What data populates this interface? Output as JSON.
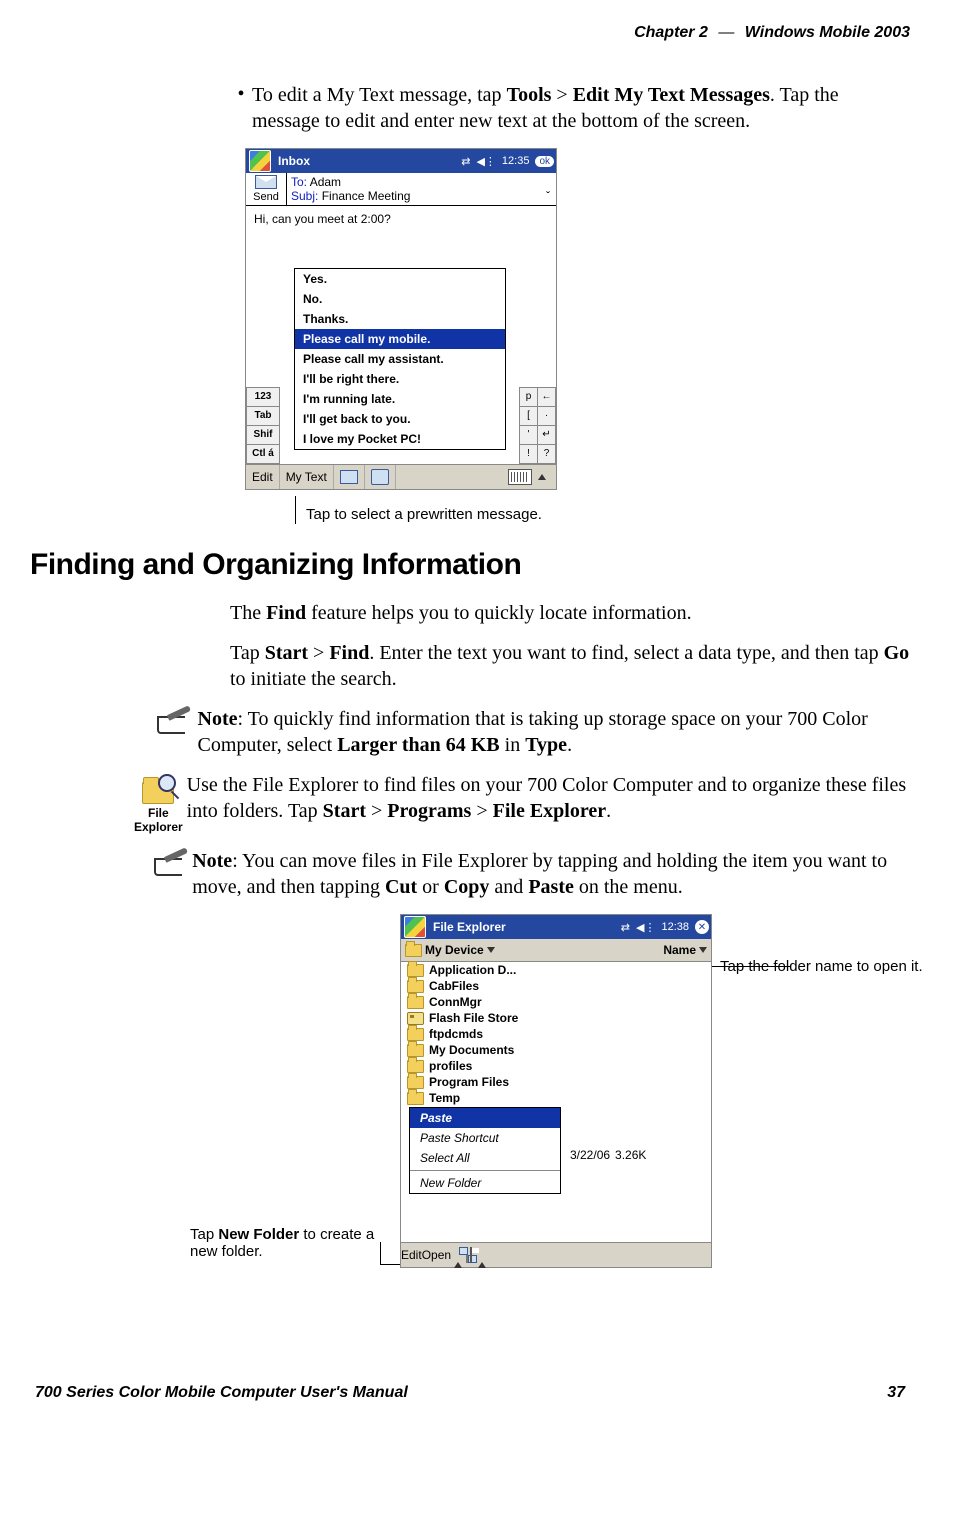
{
  "header": {
    "chapter": "Chapter  2",
    "dash": "—",
    "title": "Windows Mobile 2003"
  },
  "bullet1": {
    "pre": "To edit a My Text message, tap ",
    "b1": "Tools",
    "gt1": " > ",
    "b2": "Edit My Text Messages",
    "post": ". Tap the message to edit and enter new text at the bottom of the screen."
  },
  "inbox": {
    "title": "Inbox",
    "time": "12:35",
    "ok": "ok",
    "send": "Send",
    "to_lbl": "To:",
    "to_val": "Adam",
    "subj_lbl": "Subj:",
    "subj_val": "Finance Meeting",
    "body": "Hi, can you meet at 2:00?",
    "left_keys": [
      "123",
      "Tab",
      "Shif",
      "Ctl á"
    ],
    "right_keys": [
      [
        "p",
        "←"
      ],
      [
        "[",
        "·"
      ],
      [
        "'",
        "↵"
      ],
      [
        "!",
        "?"
      ]
    ],
    "popup": [
      "Yes.",
      "No.",
      "Thanks.",
      "Please call my mobile.",
      "Please call my assistant.",
      "I'll be right there.",
      "I'm running late.",
      "I'll get back to you.",
      "I love my Pocket PC!"
    ],
    "popup_selected_index": 3,
    "bottom": {
      "edit": "Edit",
      "mytext": "My Text"
    }
  },
  "callout1": "Tap to select a prewritten message.",
  "section_heading": "Finding and Organizing Information",
  "para1": {
    "pre": "The ",
    "b": "Find",
    "post": " feature helps you to quickly locate information."
  },
  "para2": {
    "t1": "Tap ",
    "b1": "Start",
    "gt1": " > ",
    "b2": "Find",
    "t2": ". Enter the text you want to find, select a data type, and then tap ",
    "b3": "Go",
    "t3": " to initiate the search."
  },
  "note1": {
    "lbl": "Note",
    "t1": ": To quickly find information that is taking up storage space on your 700 Color Computer, select ",
    "b1": "Larger than 64 KB",
    "t2": " in ",
    "b2": "Type",
    "t3": "."
  },
  "fe_icon_label": "File Explorer",
  "para3": {
    "t1": "Use the File Explorer to find files on your 700 Color Computer and to organize these files into folders. Tap ",
    "b1": "Start",
    "gt1": " > ",
    "b2": "Programs",
    "gt2": " > ",
    "b3": "File Explorer",
    "t2": "."
  },
  "note2": {
    "lbl": "Note",
    "t1": ": You can move files in File Explorer by tapping and holding the item you want to move, and then tapping ",
    "b1": "Cut",
    "t2": " or ",
    "b2": "Copy",
    "t3": " and ",
    "b3": "Paste",
    "t4": " on the menu."
  },
  "fe": {
    "title": "File Explorer",
    "time": "12:38",
    "path": "My Device",
    "sort": "Name",
    "rows": [
      {
        "icon": "folder",
        "name": "Application D..."
      },
      {
        "icon": "folder",
        "name": "CabFiles"
      },
      {
        "icon": "folder",
        "name": "ConnMgr"
      },
      {
        "icon": "card",
        "name": "Flash File Store"
      },
      {
        "icon": "folder",
        "name": "ftpdcmds"
      },
      {
        "icon": "folder",
        "name": "My Documents"
      },
      {
        "icon": "folder",
        "name": "profiles"
      },
      {
        "icon": "folder",
        "name": "Program Files"
      },
      {
        "icon": "folder",
        "name": "Temp"
      }
    ],
    "file_row": {
      "date": "3/22/06",
      "size": "3.26K"
    },
    "context": {
      "items": [
        "Paste",
        "Paste Shortcut",
        "Select All"
      ],
      "sel": 0,
      "newfolder": "New Folder"
    },
    "bottom": {
      "edit": "Edit",
      "open": "Open"
    }
  },
  "callout_right": "Tap the folder name to open it.",
  "callout_left": {
    "t1": "Tap ",
    "b": "New Folder",
    "t2": " to create a new folder."
  },
  "footer": {
    "left": "700 Series Color Mobile Computer User's Manual",
    "right": "37"
  }
}
